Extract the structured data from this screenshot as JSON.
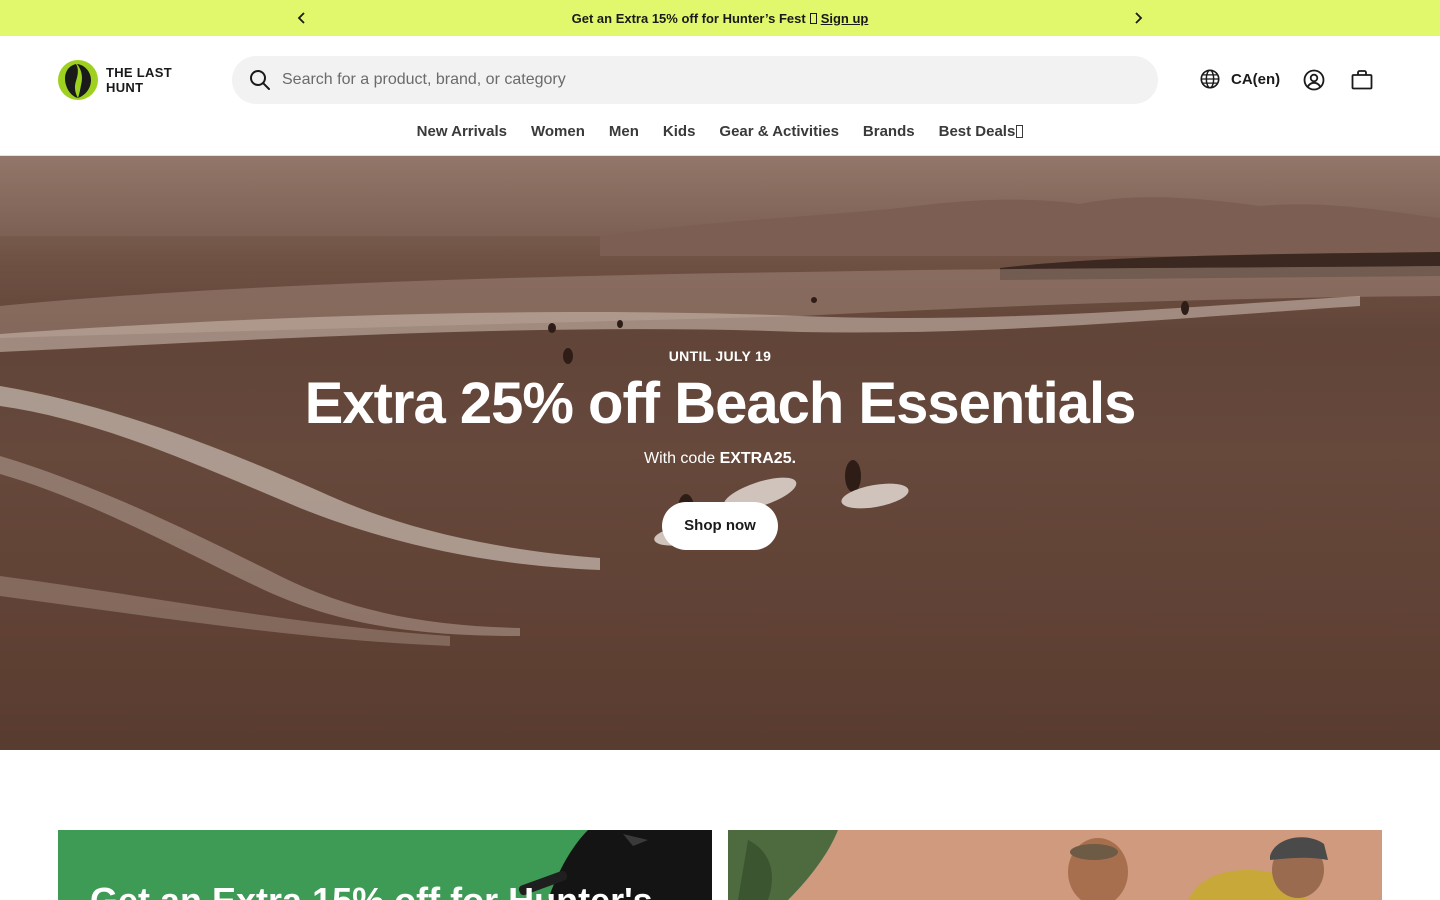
{
  "announcement": {
    "text": "Get an Extra 15% off for Hunter’s Fest",
    "link": "Sign up"
  },
  "header": {
    "logo_line1": "THE LAST",
    "logo_line2": "HUNT",
    "search_placeholder": "Search for a product, brand, or category",
    "locale": "CA(en)"
  },
  "nav": {
    "items": [
      "New Arrivals",
      "Women",
      "Men",
      "Kids",
      "Gear & Activities",
      "Brands",
      "Best Deals"
    ]
  },
  "hero": {
    "eyebrow": "UNTIL JULY 19",
    "title": "Extra 25% off Beach Essentials",
    "subtitle_prefix": "With code",
    "code": "EXTRA25.",
    "cta": "Shop now"
  },
  "cards": {
    "left_title": "Get an Extra 15% off for Hunter's"
  },
  "colors": {
    "announcement_bg": "#e1f86d",
    "logo_green": "#9ed11f",
    "card_left_bg": "#3d9b55",
    "card_right_bg": "#cf9a7e"
  }
}
